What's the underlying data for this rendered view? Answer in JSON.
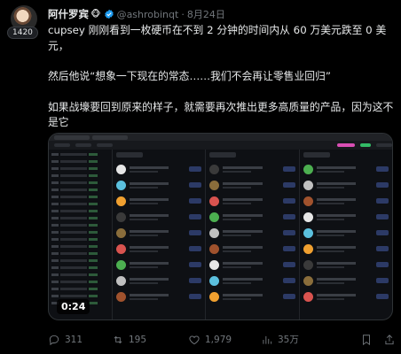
{
  "author": {
    "display_name": "阿什罗宾",
    "emoji": "🐵",
    "handle": "@ashrobinqt",
    "separator": "·",
    "date": "8月24日",
    "badge_count": "1420"
  },
  "tweet": {
    "paragraphs": [
      "cupsey 刚刚看到一枚硬币在不到 2 分钟的时间内从 60 万美元跌至 0 美元，",
      "然后他说“想象一下现在的常态……我们不会再让零售业回归”",
      "如果战壕要回到原来的样子，就需要再次推出更多高质量的产品，因为这不是它"
    ]
  },
  "media": {
    "duration": "0:24"
  },
  "actions": {
    "replies": "311",
    "retweets": "195",
    "likes": "1,979",
    "views": "35万"
  },
  "colors": {
    "background": "#000000",
    "text": "#e7e9ea",
    "muted": "#71767b",
    "verified": "#1d9bf0"
  },
  "icons": [
    "verified-icon",
    "reply-icon",
    "retweet-icon",
    "like-icon",
    "views-icon",
    "bookmark-icon",
    "share-icon"
  ]
}
